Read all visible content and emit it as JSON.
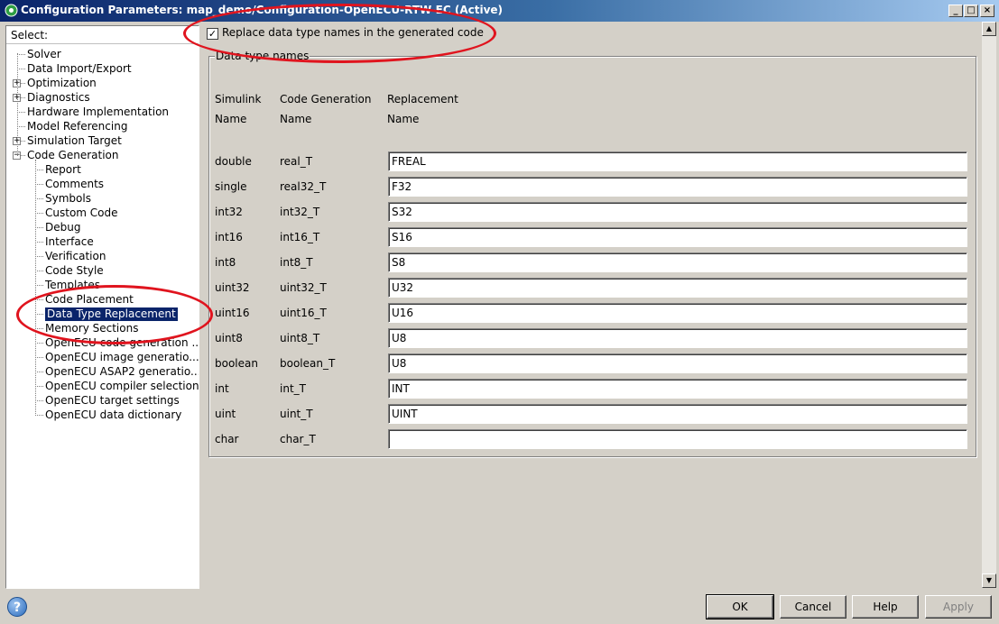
{
  "window": {
    "title": "Configuration Parameters: map_demo/Configuration-OpenECU-RTW-EC (Active)"
  },
  "tree": {
    "header": "Select:",
    "items": [
      {
        "label": "Solver",
        "level": 0,
        "expander": ""
      },
      {
        "label": "Data Import/Export",
        "level": 0,
        "expander": ""
      },
      {
        "label": "Optimization",
        "level": 0,
        "expander": "+"
      },
      {
        "label": "Diagnostics",
        "level": 0,
        "expander": "+"
      },
      {
        "label": "Hardware Implementation",
        "level": 0,
        "expander": ""
      },
      {
        "label": "Model Referencing",
        "level": 0,
        "expander": ""
      },
      {
        "label": "Simulation Target",
        "level": 0,
        "expander": "+"
      },
      {
        "label": "Code Generation",
        "level": 0,
        "expander": "−"
      },
      {
        "label": "Report",
        "level": 1,
        "expander": ""
      },
      {
        "label": "Comments",
        "level": 1,
        "expander": ""
      },
      {
        "label": "Symbols",
        "level": 1,
        "expander": ""
      },
      {
        "label": "Custom Code",
        "level": 1,
        "expander": ""
      },
      {
        "label": "Debug",
        "level": 1,
        "expander": ""
      },
      {
        "label": "Interface",
        "level": 1,
        "expander": ""
      },
      {
        "label": "Verification",
        "level": 1,
        "expander": ""
      },
      {
        "label": "Code Style",
        "level": 1,
        "expander": ""
      },
      {
        "label": "Templates",
        "level": 1,
        "expander": ""
      },
      {
        "label": "Code Placement",
        "level": 1,
        "expander": ""
      },
      {
        "label": "Data Type Replacement",
        "level": 1,
        "expander": "",
        "selected": true
      },
      {
        "label": "Memory Sections",
        "level": 1,
        "expander": ""
      },
      {
        "label": "OpenECU code generation ...",
        "level": 1,
        "expander": ""
      },
      {
        "label": "OpenECU image generatio...",
        "level": 1,
        "expander": ""
      },
      {
        "label": "OpenECU ASAP2 generatio...",
        "level": 1,
        "expander": ""
      },
      {
        "label": "OpenECU compiler selection",
        "level": 1,
        "expander": ""
      },
      {
        "label": "OpenECU target settings",
        "level": 1,
        "expander": ""
      },
      {
        "label": "OpenECU data dictionary",
        "level": 1,
        "expander": ""
      }
    ]
  },
  "main": {
    "replace_checkbox": {
      "label": "Replace data type names in the generated code",
      "checked": true,
      "mark": "✓"
    },
    "group_title": "Data type names",
    "headers": {
      "simulink": "Simulink",
      "simulink_sub": "Name",
      "codegen": "Code Generation",
      "codegen_sub": "Name",
      "replacement": "Replacement",
      "replacement_sub": "Name"
    },
    "rows": [
      {
        "simulink": "double",
        "codegen": "real_T",
        "replacement": "FREAL"
      },
      {
        "simulink": "single",
        "codegen": "real32_T",
        "replacement": "F32"
      },
      {
        "simulink": "int32",
        "codegen": "int32_T",
        "replacement": "S32"
      },
      {
        "simulink": "int16",
        "codegen": "int16_T",
        "replacement": "S16"
      },
      {
        "simulink": "int8",
        "codegen": "int8_T",
        "replacement": "S8"
      },
      {
        "simulink": "uint32",
        "codegen": "uint32_T",
        "replacement": "U32"
      },
      {
        "simulink": "uint16",
        "codegen": "uint16_T",
        "replacement": "U16"
      },
      {
        "simulink": "uint8",
        "codegen": "uint8_T",
        "replacement": "U8"
      },
      {
        "simulink": "boolean",
        "codegen": "boolean_T",
        "replacement": "U8"
      },
      {
        "simulink": "int",
        "codegen": "int_T",
        "replacement": "INT"
      },
      {
        "simulink": "uint",
        "codegen": "uint_T",
        "replacement": "UINT"
      },
      {
        "simulink": "char",
        "codegen": "char_T",
        "replacement": ""
      }
    ]
  },
  "buttons": {
    "ok": "OK",
    "cancel": "Cancel",
    "help": "Help",
    "apply": "Apply",
    "help_icon": "?"
  },
  "colors": {
    "annotation": "#e0141e",
    "selection": "#0a246a"
  }
}
